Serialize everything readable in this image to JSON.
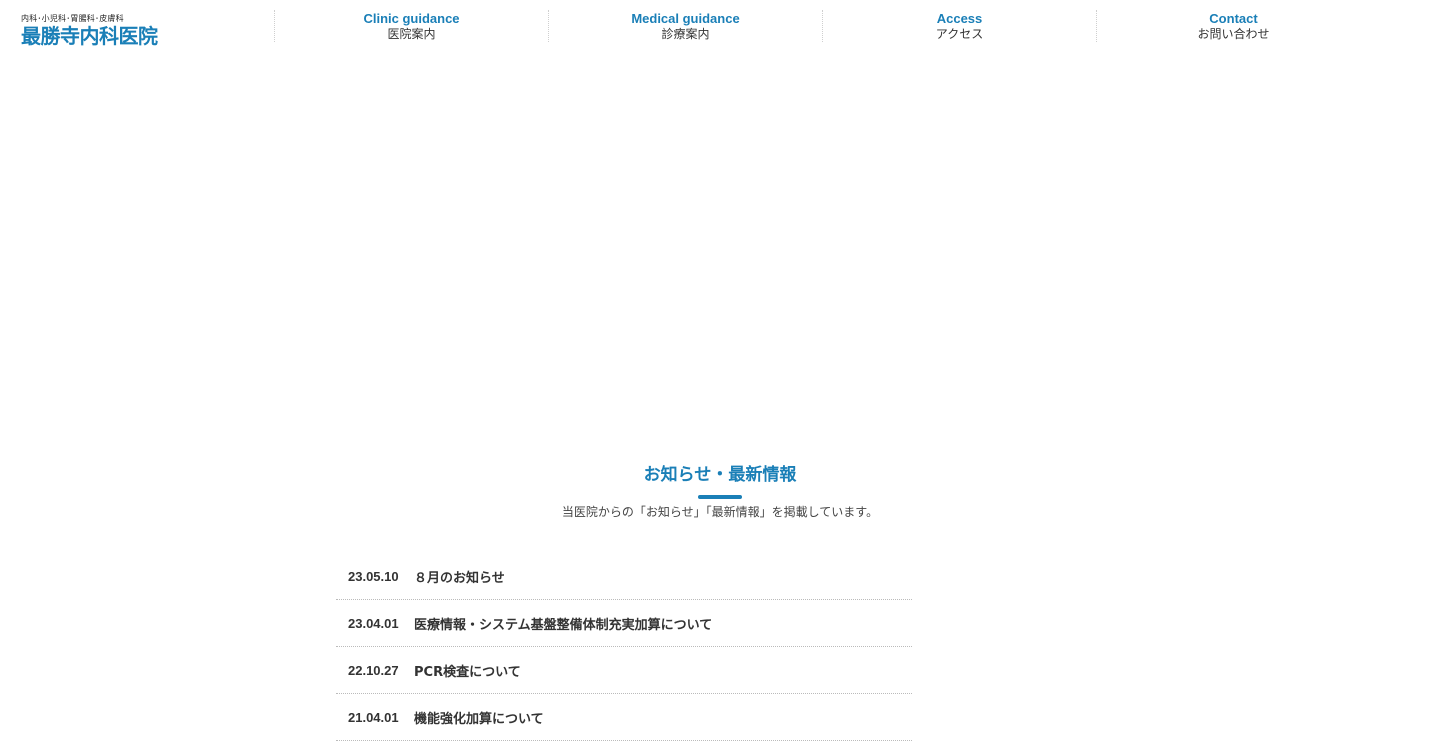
{
  "header": {
    "logo_sub": "内科･小児科･胃腸科･皮膚科",
    "logo_main": "最勝寺内科医院"
  },
  "nav": {
    "items": [
      {
        "en": "Clinic guidance",
        "ja": "医院案内"
      },
      {
        "en": "Medical guidance",
        "ja": "診療案内"
      },
      {
        "en": "Access",
        "ja": "アクセス"
      },
      {
        "en": "Contact",
        "ja": "お問い合わせ"
      }
    ]
  },
  "news": {
    "title": "お知らせ・最新情報",
    "lead": "当医院からの「お知らせ」「最新情報」を掲載しています。",
    "items": [
      {
        "date": "23.05.10",
        "text": "８月のお知らせ"
      },
      {
        "date": "23.04.01",
        "text": "医療情報・システム基盤整備体制充実加算について"
      },
      {
        "date": "22.10.27",
        "text": "PCR検査について"
      },
      {
        "date": "21.04.01",
        "text": "機能強化加算について"
      }
    ]
  },
  "colors": {
    "accent": "#1a7fb7",
    "text": "#333333"
  }
}
